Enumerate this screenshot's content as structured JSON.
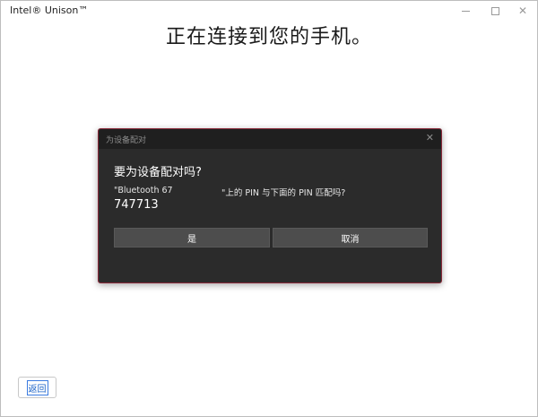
{
  "window": {
    "title": "Intel® Unison™"
  },
  "page": {
    "heading": "正在连接到您的手机。"
  },
  "dialog": {
    "title": "为设备配对",
    "question": "要为设备配对吗?",
    "message_part1": "\"Bluetooth 67",
    "message_part2": "\"上的 PIN 与下面的 PIN 匹配吗?",
    "pin": "747713",
    "yes_label": "是",
    "cancel_label": "取消"
  },
  "footer": {
    "back_label": "返回"
  },
  "colors": {
    "dialog_bg": "#2b2b2b",
    "dialog_border": "#8a2a3a",
    "button_bg": "#4d4d4d",
    "link_blue": "#1a62c7"
  },
  "icons": {
    "minimize": "minimize-icon",
    "maximize": "maximize-icon",
    "close": "close-icon",
    "dialog_close": "close-icon"
  }
}
